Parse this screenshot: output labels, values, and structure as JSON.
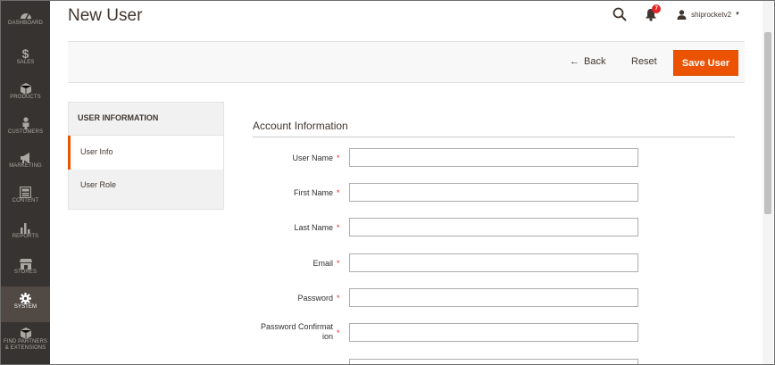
{
  "admin_menu": {
    "items": [
      {
        "label": "DASHBOARD",
        "icon": "dashboard-icon"
      },
      {
        "label": "SALES",
        "icon": "dollar-icon"
      },
      {
        "label": "PRODUCTS",
        "icon": "cube-icon"
      },
      {
        "label": "CUSTOMERS",
        "icon": "person-icon"
      },
      {
        "label": "MARKETING",
        "icon": "megaphone-icon"
      },
      {
        "label": "CONTENT",
        "icon": "layout-icon"
      },
      {
        "label": "REPORTS",
        "icon": "bar-chart-icon"
      },
      {
        "label": "STORES",
        "icon": "store-icon"
      },
      {
        "label": "SYSTEM",
        "icon": "gear-icon"
      },
      {
        "label_line1": "FIND PARTNERS",
        "label_line2": "& EXTENSIONS",
        "icon": "puzzle-cube-icon"
      }
    ],
    "active": "SYSTEM"
  },
  "header": {
    "title": "New User",
    "notifications_count": "7",
    "username": "shiprocketv2"
  },
  "actions": {
    "back_label": "Back",
    "reset_label": "Reset",
    "save_label": "Save User"
  },
  "tabs": {
    "title": "USER INFORMATION",
    "items": [
      {
        "label": "User Info",
        "active": true
      },
      {
        "label": "User Role",
        "active": false
      }
    ]
  },
  "form": {
    "fieldset_title": "Account Information",
    "required_mark": "*",
    "fields": [
      {
        "label": "User Name",
        "value": ""
      },
      {
        "label": "First Name",
        "value": ""
      },
      {
        "label": "Last Name",
        "value": ""
      },
      {
        "label": "Email",
        "value": ""
      },
      {
        "label": "Password",
        "value": ""
      },
      {
        "label_line1": "Password Confirmat",
        "label_line2": "ion",
        "value": ""
      }
    ]
  },
  "colors": {
    "accent": "#eb5202",
    "menu_bg": "#373330",
    "menu_active_bg": "#514943",
    "required": "#e02b27"
  }
}
